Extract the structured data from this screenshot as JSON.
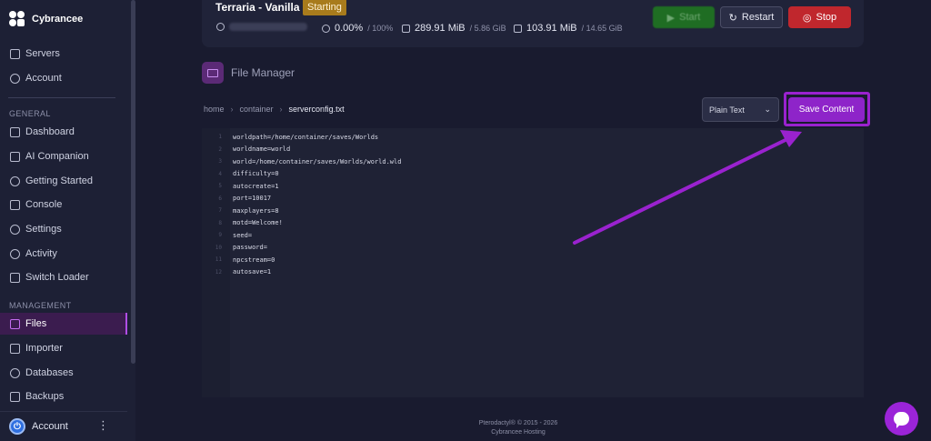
{
  "brand": {
    "name": "Cybrancee"
  },
  "sidebar": {
    "top_items": [
      {
        "label": "Servers",
        "icon": "server-icon"
      },
      {
        "label": "Account",
        "icon": "account-icon"
      }
    ],
    "general_title": "GENERAL",
    "general_items": [
      {
        "label": "Dashboard",
        "icon": "dashboard-icon"
      },
      {
        "label": "AI Companion",
        "icon": "ai-icon"
      },
      {
        "label": "Getting Started",
        "icon": "help-icon"
      },
      {
        "label": "Console",
        "icon": "console-icon"
      },
      {
        "label": "Settings",
        "icon": "gear-icon"
      },
      {
        "label": "Activity",
        "icon": "eye-icon"
      },
      {
        "label": "Switch Loader",
        "icon": "switch-icon"
      }
    ],
    "management_title": "MANAGEMENT",
    "management_items": [
      {
        "label": "Files",
        "icon": "folder-icon",
        "active": true
      },
      {
        "label": "Importer",
        "icon": "download-icon"
      },
      {
        "label": "Databases",
        "icon": "database-icon"
      },
      {
        "label": "Backups",
        "icon": "archive-icon"
      }
    ],
    "account_label": "Account"
  },
  "server": {
    "title": "Terraria - Vanilla",
    "status": "Starting",
    "cpu": "0.00%",
    "cpu_limit": "/ 100%",
    "memory": "289.91 MiB",
    "memory_limit": "/ 5.86 GiB",
    "disk": "103.91 MiB",
    "disk_limit": "/ 14.65 GiB",
    "start_label": "Start",
    "restart_label": "Restart",
    "stop_label": "Stop"
  },
  "file_manager": {
    "title": "File Manager",
    "breadcrumb": [
      "home",
      "container",
      "serverconfig.txt"
    ],
    "mode": "Plain Text",
    "save_label": "Save Content"
  },
  "editor": {
    "lines": [
      "worldpath=/home/container/saves/Worlds",
      "worldname=world",
      "world=/home/container/saves/Worlds/world.wld",
      "difficulty=0",
      "autocreate=1",
      "port=10017",
      "maxplayers=8",
      "motd=Welcome!",
      "seed=",
      "password=",
      "npcstream=0",
      "autosave=1"
    ]
  },
  "footer": {
    "line1": "Pterodactyl® © 2015 - 2026",
    "line2": "Cybrancee Hosting"
  },
  "colors": {
    "accent": "#8e24c9",
    "annotation": "#9a22cf",
    "status": "#a87b1c",
    "stop": "#c0272d",
    "start": "#1f6d23"
  }
}
